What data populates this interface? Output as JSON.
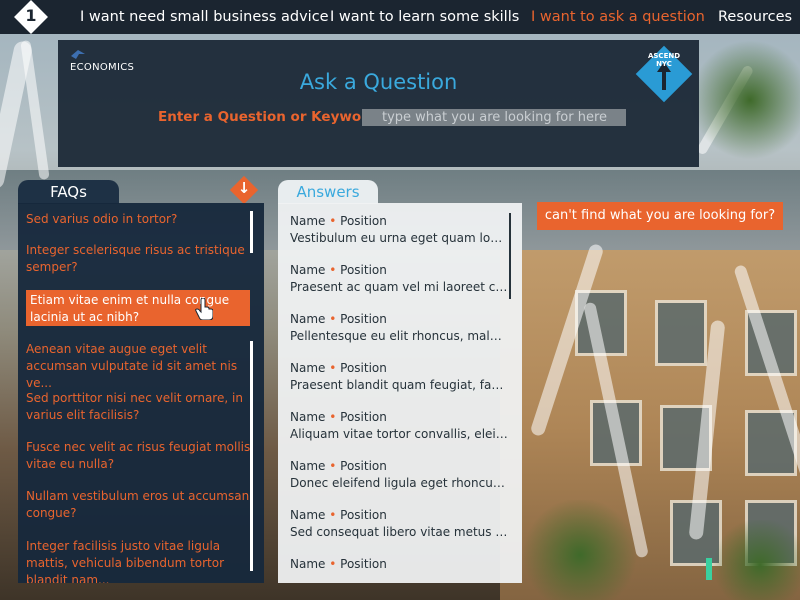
{
  "nav": {
    "items": [
      {
        "label": "I want need small business advice",
        "active": false
      },
      {
        "label": "I want to learn some skills",
        "active": false
      },
      {
        "label": "I want to ask a question",
        "active": true
      },
      {
        "label": "Resources",
        "active": false
      }
    ],
    "logo_number": "1"
  },
  "header": {
    "econ_label": "ECONOMICS",
    "title": "Ask a Question",
    "keyword_label": "Enter a Question or Keyword:",
    "search_placeholder": "type what you are looking for here",
    "badge_label": "ASCEND NYC"
  },
  "faq": {
    "tab_label": "FAQs",
    "items": [
      {
        "text": "Sed varius odio in tortor?",
        "active": false
      },
      {
        "text": "Integer scelerisque risus ac tristique semper?",
        "active": false
      },
      {
        "text": "Etiam vitae enim et nulla congue lacinia ut ac nibh?",
        "active": true
      },
      {
        "text": "Aenean vitae augue eget velit accumsan vulputate id sit amet nis ve...",
        "active": false
      },
      {
        "text": "Sed porttitor nisi nec velit ornare, in varius elit facilisis?",
        "active": false
      },
      {
        "text": "Fusce nec velit ac risus feugiat mollis vitae eu nulla?",
        "active": false
      },
      {
        "text": "Nullam vestibulum eros ut accumsan congue?",
        "active": false
      },
      {
        "text": "Integer facilisis justo vitae ligula mattis, vehicula bibendum tortor blandit nam...",
        "active": false
      }
    ]
  },
  "answers": {
    "tab_label": "Answers",
    "items": [
      {
        "name": "Name",
        "position": "Position",
        "snippet": "Vestibulum eu urna eget quam lobor..."
      },
      {
        "name": "Name",
        "position": "Position",
        "snippet": "Praesent ac quam vel mi laoreet con..."
      },
      {
        "name": "Name",
        "position": "Position",
        "snippet": "Pellentesque eu elit rhoncus, malesu..."
      },
      {
        "name": "Name",
        "position": "Position",
        "snippet": "Praesent blandit quam feugiat, facili..."
      },
      {
        "name": "Name",
        "position": "Position",
        "snippet": "Aliquam vitae tortor convallis, eleif..."
      },
      {
        "name": "Name",
        "position": "Position",
        "snippet": "Donec eleifend ligula eget rhoncus u..."
      },
      {
        "name": "Name",
        "position": "Position",
        "snippet": "Sed consequat libero vitae metus m..."
      },
      {
        "name": "Name",
        "position": "Position",
        "snippet": ""
      }
    ]
  },
  "cant_find_label": "can't find what you are looking for?",
  "colors": {
    "accent_orange": "#e9642e",
    "accent_blue": "#3aa9dd",
    "panel_dark": "#16283c"
  },
  "icons": {
    "logo": "ascend-1-diamond-icon",
    "down": "arrow-down-icon",
    "cursor": "hand-cursor-icon",
    "brand": "bird-icon"
  }
}
